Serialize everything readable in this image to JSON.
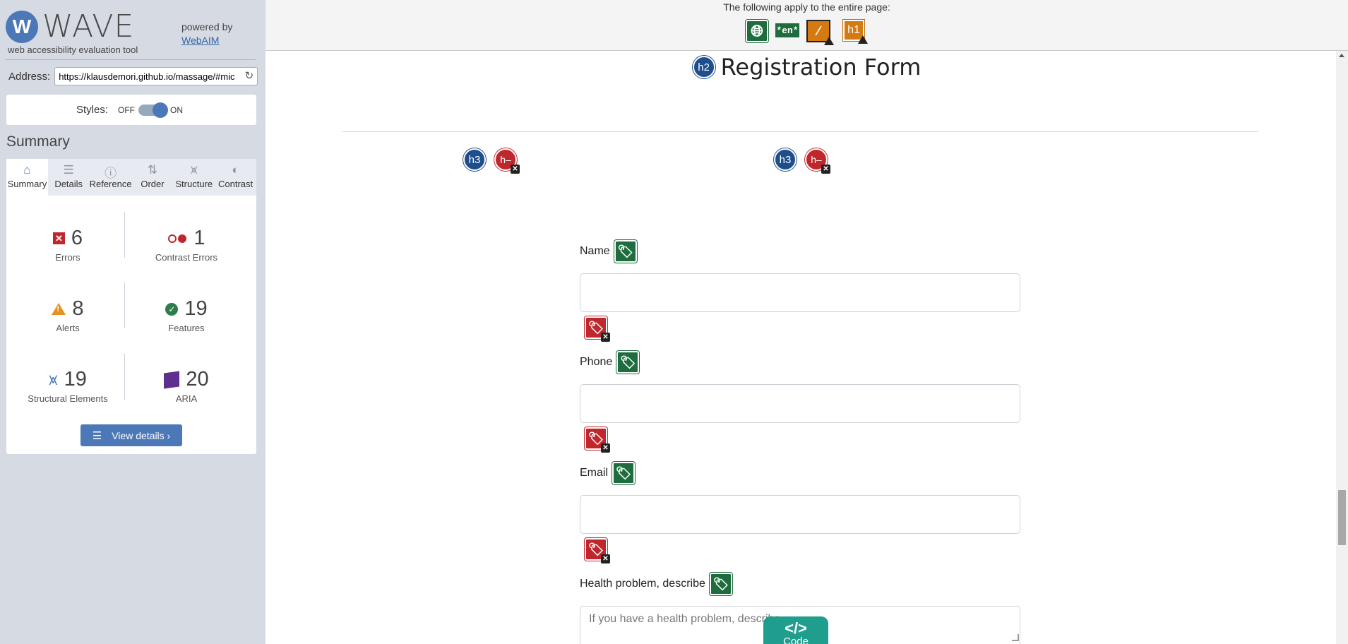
{
  "wave": {
    "logo_letter": "W",
    "logo_text": "WAVE",
    "tagline": "web accessibility evaluation tool",
    "powered_by": "powered by",
    "powered_link": "WebAIM",
    "address_label": "Address:",
    "address_value": "https://klausdemori.github.io/massage/#mic",
    "styles_label": "Styles:",
    "styles_off": "OFF",
    "styles_on": "ON",
    "styles_state": "on",
    "summary_heading": "Summary",
    "tabs": [
      {
        "label": "Summary",
        "icon": "home-icon",
        "glyph": "⌂"
      },
      {
        "label": "Details",
        "icon": "list-icon",
        "glyph": "☰"
      },
      {
        "label": "Reference",
        "icon": "info-icon",
        "glyph": "ⓘ"
      },
      {
        "label": "Order",
        "icon": "order-icon",
        "glyph": "⇅"
      },
      {
        "label": "Structure",
        "icon": "structure-icon",
        "glyph": "⩙"
      },
      {
        "label": "Contrast",
        "icon": "contrast-icon",
        "glyph": "◐"
      }
    ],
    "active_tab": "Summary",
    "stats": {
      "errors": {
        "value": "6",
        "label": "Errors"
      },
      "contrast_errors": {
        "value": "1",
        "label": "Contrast Errors"
      },
      "alerts": {
        "value": "8",
        "label": "Alerts"
      },
      "features": {
        "value": "19",
        "label": "Features"
      },
      "structural": {
        "value": "19",
        "label": "Structural Elements"
      },
      "aria": {
        "value": "20",
        "label": "ARIA"
      }
    },
    "view_details": "View details ›"
  },
  "page": {
    "banner_text": "The following apply to the entire page:",
    "lang_en_text": "*en*",
    "h1_text": "h1",
    "h2_text": "h2",
    "h3_text": "h3",
    "hminus_text": "h–",
    "title": "Registration Form",
    "fields": [
      {
        "label": "Name",
        "placeholder": ""
      },
      {
        "label": "Phone",
        "placeholder": ""
      },
      {
        "label": "Email",
        "placeholder": ""
      },
      {
        "label": "Health problem, describe",
        "placeholder": "If you have a health problem, describe"
      }
    ],
    "code_glyph": "</>",
    "code_label": "Code"
  },
  "colors": {
    "sidebar_bg": "#d6dbe3",
    "wave_blue": "#4d78b7",
    "error_red": "#c0272d",
    "feature_green": "#1f6d3f",
    "alert_orange": "#d47a10",
    "structure_navy": "#1f4e8c",
    "aria_purple": "#5e2f8e",
    "code_teal": "#1f9e8e"
  }
}
